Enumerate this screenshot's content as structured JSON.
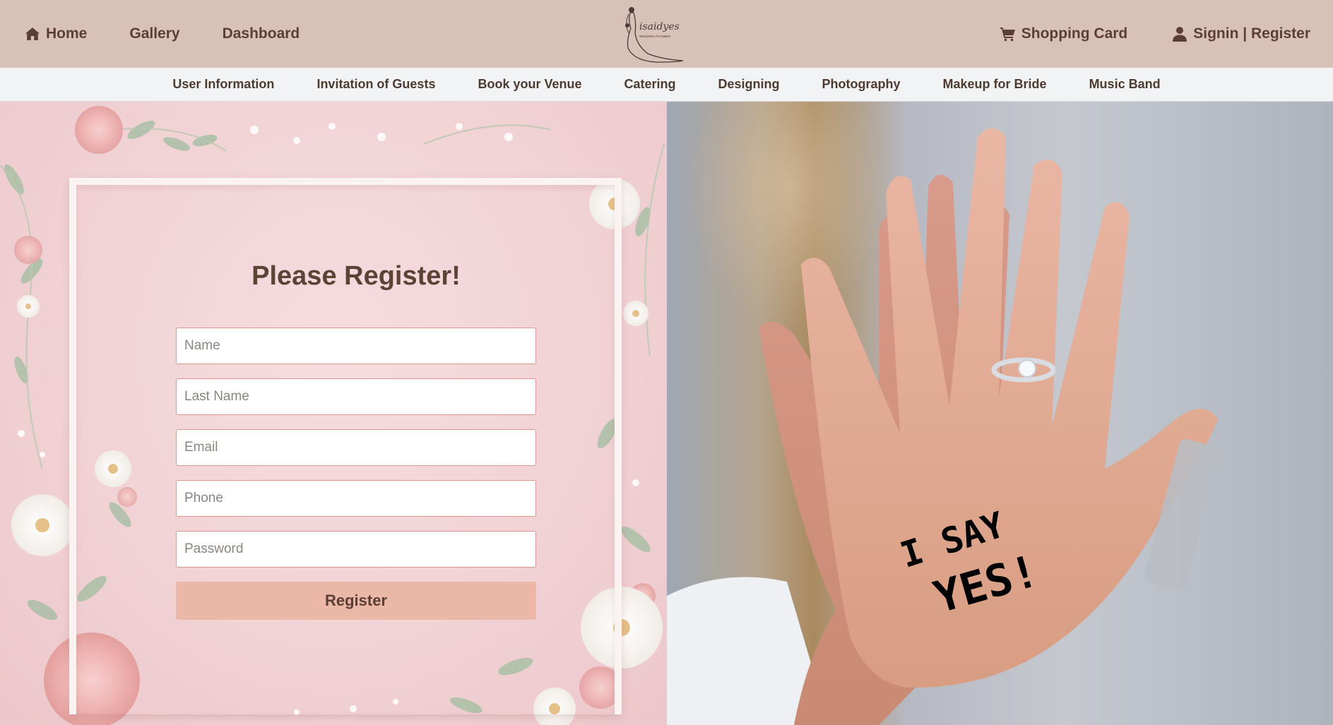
{
  "header": {
    "left_links": [
      {
        "label": "Home",
        "icon": "home-icon"
      },
      {
        "label": "Gallery"
      },
      {
        "label": "Dashboard"
      }
    ],
    "right_links": [
      {
        "label": "Shopping Card",
        "icon": "cart-icon"
      },
      {
        "label": "Signin | Register",
        "icon": "user-icon"
      }
    ],
    "logo": {
      "text": "isaidyes",
      "subtext": "WEDDING PLANNER"
    }
  },
  "subnav": {
    "items": [
      "User Information",
      "Invitation of Guests",
      "Book your Venue",
      "Catering",
      "Designing",
      "Photography",
      "Makeup for Bride",
      "Music Band"
    ]
  },
  "form": {
    "title": "Please Register!",
    "fields": [
      {
        "placeholder": "Name",
        "value": ""
      },
      {
        "placeholder": "Last Name",
        "value": ""
      },
      {
        "placeholder": "Email",
        "value": ""
      },
      {
        "placeholder": "Phone",
        "value": ""
      },
      {
        "placeholder": "Password",
        "value": ""
      }
    ],
    "submit_label": "Register"
  },
  "photo": {
    "palm_text_line1": "I SAY",
    "palm_text_line2": "YES!"
  },
  "colors": {
    "header_bg": "#d8c2b7",
    "subnav_bg": "#f1f3f5",
    "button_bg": "#ebb7a7",
    "text_brown": "#5b3f34",
    "input_border": "#d99a8e"
  }
}
